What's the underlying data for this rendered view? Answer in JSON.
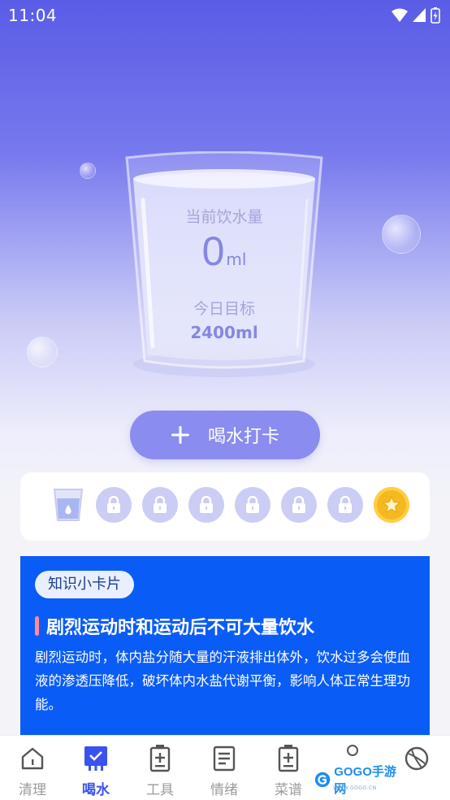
{
  "status_bar": {
    "time": "11:04"
  },
  "water": {
    "current_label": "当前饮水量",
    "current_value": "0",
    "current_unit": "ml",
    "goal_label": "今日目标",
    "goal_value": "2400ml"
  },
  "checkin_button": {
    "label": "喝水打卡"
  },
  "progress": {
    "cups_total": 8,
    "cups_done": 0,
    "reward": "coin"
  },
  "knowledge": {
    "tag": "知识小卡片",
    "title": "剧烈运动时和运动后不可大量饮水",
    "body": "剧烈运动时，体内盐分随大量的汗液排出体外，饮水过多会使血液的渗透压降低，破坏体内水盐代谢平衡，影响人体正常生理功能。"
  },
  "tabbar": {
    "tabs": [
      {
        "label": "清理",
        "icon": "home-icon"
      },
      {
        "label": "喝水",
        "icon": "cup-check-icon",
        "active": true
      },
      {
        "label": "工具",
        "icon": "battery-icon"
      },
      {
        "label": "情绪",
        "icon": "document-icon"
      },
      {
        "label": "菜谱",
        "icon": "battery-plus-icon"
      },
      {
        "label": "",
        "icon": "pin-icon"
      },
      {
        "label": "",
        "icon": "ball-icon"
      }
    ]
  },
  "watermark": {
    "text": "GOGO手游网",
    "sub": "WWW.GOGO.CN"
  },
  "colors": {
    "accent": "#8a8cf0",
    "card_blue": "#0a5cf7",
    "active_tab": "#3a52f0"
  }
}
